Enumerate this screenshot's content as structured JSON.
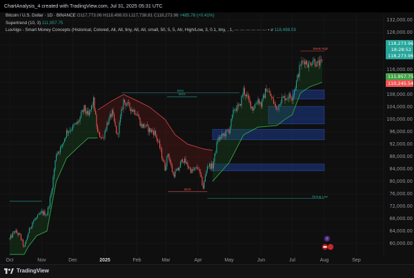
{
  "header": {
    "text": "ChartAnalysis_4 created with TradingView.com, Jul 31, 2025 05:31 UTC"
  },
  "legend": {
    "line1": {
      "symbol": "Bitcoin / U.S. Dollar · 1D · BINANCE",
      "o": "O117,773.06",
      "h": "H118,498.03",
      "l": "L117,738.81",
      "c": "C118,273.96",
      "chg": "+485.78 (+0.41%)"
    },
    "line2": {
      "name": "Supertrend (10, 3)",
      "value": "111,957.75"
    },
    "line3": {
      "name": "LuxAlgo - Smart Money Concepts (Historical, Colored, All, All, tiny, All, All, small, 50, 5, 5, Atr, High/Low, 3, 0.1, tiny, , 1,",
      "value": "118,498.03"
    }
  },
  "tags": {
    "price_green_1": "118,273.96",
    "countdown": "18:28:52",
    "price_green_2": "118,273.96",
    "supertrend": "111,957.75",
    "red_level": "110,245.54"
  },
  "colors": {
    "bull": "#26a69a",
    "bear": "#ef5350",
    "supertrend_up": "#2e9e47",
    "supertrend_down": "#c23a3a",
    "ob_blue": "#1e3a8a",
    "bg": "#0f0f0f"
  },
  "footer": {
    "logo": "TradingView"
  },
  "chart_data": {
    "type": "candlestick",
    "title": "Bitcoin / U.S. Dollar · 1D · BINANCE",
    "ylim": [
      56000,
      134000
    ],
    "y_ticks": [
      "132,000.00",
      "128,000.00",
      "124,000.00",
      "120,000.00",
      "116,000.00",
      "112,000.00",
      "108,000.00",
      "104,000.00",
      "100,000.00",
      "96,000.00",
      "92,000.00",
      "88,000.00",
      "84,000.00",
      "80,000.00",
      "76,000.00",
      "72,000.00",
      "68,000.00",
      "64,000.00",
      "60,000.00"
    ],
    "y_tick_values": [
      132000,
      128000,
      124000,
      120000,
      116000,
      112000,
      108000,
      104000,
      100000,
      96000,
      92000,
      88000,
      84000,
      80000,
      76000,
      72000,
      68000,
      64000,
      60000
    ],
    "x_ticks": [
      "Oct",
      "Nov",
      "Dec",
      "2025",
      "Feb",
      "Mar",
      "Apr",
      "May",
      "Jun",
      "Jul",
      "Aug",
      "Sep"
    ],
    "x_tick_days": [
      0,
      31,
      61,
      92,
      123,
      151,
      182,
      212,
      243,
      273,
      304,
      335
    ],
    "last_day": 302,
    "price_path": [
      [
        0,
        61500
      ],
      [
        5,
        64000
      ],
      [
        10,
        62500
      ],
      [
        14,
        58600
      ],
      [
        18,
        63500
      ],
      [
        22,
        67000
      ],
      [
        26,
        68200
      ],
      [
        31,
        70000
      ],
      [
        36,
        69500
      ],
      [
        40,
        76000
      ],
      [
        45,
        89000
      ],
      [
        50,
        91000
      ],
      [
        55,
        96000
      ],
      [
        61,
        97500
      ],
      [
        66,
        99000
      ],
      [
        72,
        103500
      ],
      [
        76,
        101000
      ],
      [
        81,
        106000
      ],
      [
        85,
        95500
      ],
      [
        90,
        93800
      ],
      [
        94,
        98500
      ],
      [
        99,
        102000
      ],
      [
        104,
        94500
      ],
      [
        110,
        106000
      ],
      [
        114,
        104500
      ],
      [
        119,
        103000
      ],
      [
        123,
        102000
      ],
      [
        127,
        98000
      ],
      [
        131,
        97800
      ],
      [
        135,
        96500
      ],
      [
        140,
        95800
      ],
      [
        145,
        91000
      ],
      [
        150,
        84200
      ],
      [
        153,
        89000
      ],
      [
        158,
        82000
      ],
      [
        163,
        83800
      ],
      [
        167,
        87300
      ],
      [
        172,
        85000
      ],
      [
        176,
        83200
      ],
      [
        182,
        84500
      ],
      [
        187,
        78000
      ],
      [
        191,
        85200
      ],
      [
        196,
        84800
      ],
      [
        201,
        93500
      ],
      [
        206,
        94800
      ],
      [
        212,
        96500
      ],
      [
        217,
        103500
      ],
      [
        222,
        104000
      ],
      [
        226,
        109500
      ],
      [
        231,
        106000
      ],
      [
        235,
        103500
      ],
      [
        240,
        106500
      ],
      [
        243,
        104600
      ],
      [
        248,
        110000
      ],
      [
        253,
        107000
      ],
      [
        258,
        103200
      ],
      [
        262,
        106500
      ],
      [
        266,
        107100
      ],
      [
        270,
        107500
      ],
      [
        273,
        107200
      ],
      [
        277,
        112000
      ],
      [
        281,
        117800
      ],
      [
        285,
        119000
      ],
      [
        289,
        117500
      ],
      [
        293,
        119300
      ],
      [
        297,
        117800
      ],
      [
        300,
        118100
      ],
      [
        302,
        118273.96
      ]
    ],
    "supertrend_segments": [
      {
        "dir": "up",
        "pts": [
          [
            0,
            56500
          ],
          [
            14,
            56500
          ],
          [
            18,
            59000
          ],
          [
            26,
            62500
          ],
          [
            36,
            64000
          ],
          [
            45,
            80000
          ],
          [
            55,
            87500
          ],
          [
            66,
            91000
          ],
          [
            76,
            94000
          ],
          [
            85,
            94000
          ]
        ]
      },
      {
        "dir": "down",
        "pts": [
          [
            85,
            103000
          ],
          [
            99,
            106000
          ],
          [
            110,
            108000
          ],
          [
            123,
            106000
          ],
          [
            135,
            104000
          ],
          [
            150,
            100000
          ],
          [
            160,
            95000
          ],
          [
            172,
            92000
          ],
          [
            187,
            90500
          ],
          [
            196,
            90000
          ]
        ]
      },
      {
        "dir": "up",
        "pts": [
          [
            196,
            80000
          ],
          [
            212,
            86000
          ],
          [
            226,
            95000
          ],
          [
            240,
            97500
          ],
          [
            258,
            98000
          ],
          [
            266,
            100000
          ],
          [
            273,
            101500
          ],
          [
            281,
            108500
          ],
          [
            290,
            110500
          ],
          [
            302,
            111957.75
          ]
        ]
      }
    ],
    "order_blocks": [
      {
        "from_day": 273,
        "to_day": 304,
        "low": 106500,
        "high": 109500
      },
      {
        "from_day": 250,
        "to_day": 304,
        "low": 98500,
        "high": 104200
      },
      {
        "from_day": 196,
        "to_day": 304,
        "low": 93400,
        "high": 96800
      },
      {
        "from_day": 196,
        "to_day": 304,
        "low": 83400,
        "high": 85600
      }
    ],
    "structure_lines": [
      {
        "label": "BOS",
        "y": 108500,
        "from_day": 108,
        "to_day": 222,
        "color": "#26a69a"
      },
      {
        "label": "BOS",
        "y": 107300,
        "from_day": 152,
        "to_day": 181,
        "color": "#26a69a"
      },
      {
        "label": "BOS",
        "y": 76700,
        "from_day": 153,
        "to_day": 191,
        "color": "#ef5350"
      },
      {
        "label": "",
        "y": 107000,
        "from_day": 258,
        "to_day": 266,
        "color": "#ef5350"
      }
    ],
    "annotations": [
      {
        "text": "Weak High",
        "day": 293,
        "y": 122500,
        "color": "#ef5350"
      },
      {
        "text": "Strong Low",
        "day": 292,
        "y": 74800,
        "color": "#26a69a"
      }
    ],
    "level_lines": [
      {
        "y": 122000,
        "from_day": 281,
        "to_day": 304,
        "color": "#ef5350"
      },
      {
        "y": 74500,
        "from_day": 191,
        "to_day": 304,
        "color": "#26a69a"
      },
      {
        "y": 73600,
        "from_day": 0,
        "to_day": 31,
        "color": "#26a69a"
      }
    ]
  }
}
